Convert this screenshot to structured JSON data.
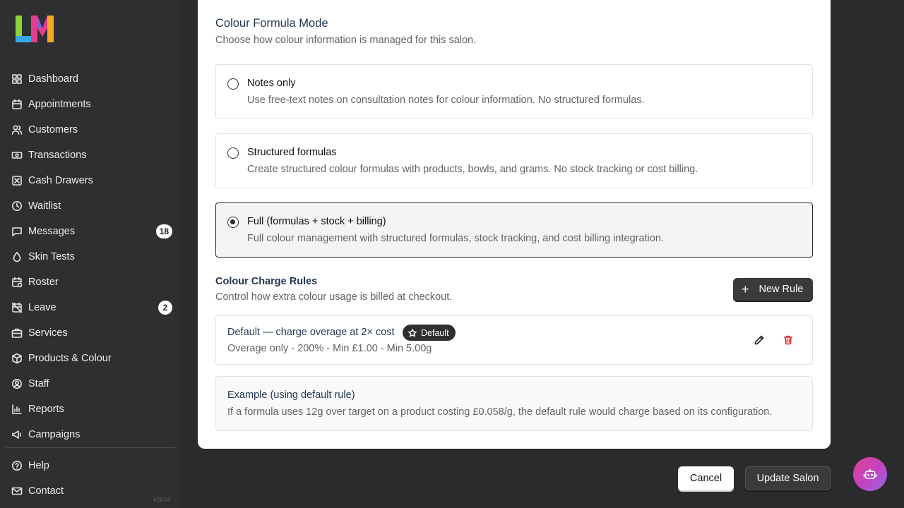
{
  "colors": {
    "sidebar_bg": "#2f2f31",
    "page_bg": "#2b2b2d",
    "title_navy": "#1f3550",
    "muted_text": "#5f6368",
    "danger_red": "#e03131",
    "bot_gradient_start": "#e23d8f",
    "bot_gradient_end": "#8f6ae0"
  },
  "sidebar": {
    "logo_icon": "lm-logo-icon",
    "items": [
      {
        "label": "Dashboard",
        "icon": "grid-icon"
      },
      {
        "label": "Appointments",
        "icon": "calendar-icon"
      },
      {
        "label": "Customers",
        "icon": "users-icon"
      },
      {
        "label": "Transactions",
        "icon": "banknote-icon"
      },
      {
        "label": "Cash Drawers",
        "icon": "box-x-icon"
      },
      {
        "label": "Waitlist",
        "icon": "clock-icon"
      },
      {
        "label": "Messages",
        "icon": "chat-icon",
        "badge": "18"
      },
      {
        "label": "Skin Tests",
        "icon": "droplet-icon"
      },
      {
        "label": "Roster",
        "icon": "calendar-clock-icon"
      },
      {
        "label": "Leave",
        "icon": "calendar-off-icon",
        "badge": "2"
      },
      {
        "label": "Services",
        "icon": "briefcase-icon"
      },
      {
        "label": "Products & Colour",
        "icon": "package-icon"
      },
      {
        "label": "Staff",
        "icon": "user-circle-icon"
      },
      {
        "label": "Reports",
        "icon": "bar-chart-icon"
      },
      {
        "label": "Campaigns",
        "icon": "megaphone-icon"
      }
    ],
    "bottom_items": [
      {
        "label": "Help",
        "icon": "help-circle-icon"
      },
      {
        "label": "Contact",
        "icon": "mail-icon"
      }
    ],
    "version": "v2604"
  },
  "formula_mode": {
    "title": "Colour Formula Mode",
    "subtitle": "Choose how colour information is managed for this salon.",
    "options": [
      {
        "title": "Notes only",
        "description": "Use free-text notes on consultation notes for colour information. No structured formulas.",
        "selected": false
      },
      {
        "title": "Structured formulas",
        "description": "Create structured colour formulas with products, bowls, and grams. No stock tracking or cost billing.",
        "selected": false
      },
      {
        "title": "Full (formulas + stock + billing)",
        "description": "Full colour management with structured formulas, stock tracking, and cost billing integration.",
        "selected": true
      }
    ]
  },
  "charge_rules": {
    "title": "Colour Charge Rules",
    "subtitle": "Control how extra colour usage is billed at checkout.",
    "new_rule_label": "New Rule",
    "rules": [
      {
        "title": "Default — charge overage at 2× cost",
        "badge": "Default",
        "description": "Overage only - 200% - Min £1.00 - Min 5.00g"
      }
    ],
    "example": {
      "title": "Example (using default rule)",
      "text": "If a formula uses 12g over target on a product costing £0.058/g, the default rule would charge based on its configuration."
    }
  },
  "footer": {
    "cancel_label": "Cancel",
    "update_label": "Update Salon"
  }
}
